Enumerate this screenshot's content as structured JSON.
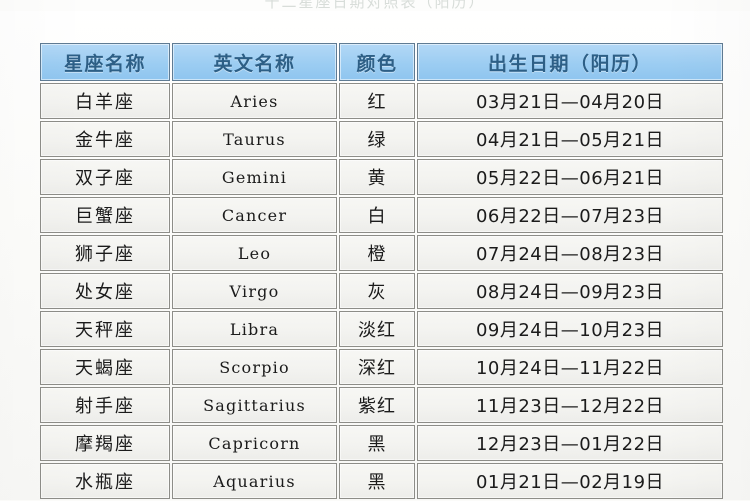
{
  "page": {
    "top_title_fragment": "十二星座日期对照表（阳历）"
  },
  "table": {
    "headers": [
      "星座名称",
      "英文名称",
      "颜色",
      "出生日期（阳历）"
    ],
    "rows": [
      {
        "name": "白羊座",
        "english": "Aries",
        "color": "红",
        "date": "03月21日—04月20日"
      },
      {
        "name": "金牛座",
        "english": "Taurus",
        "color": "绿",
        "date": "04月21日—05月21日"
      },
      {
        "name": "双子座",
        "english": "Gemini",
        "color": "黄",
        "date": "05月22日—06月21日"
      },
      {
        "name": "巨蟹座",
        "english": "Cancer",
        "color": "白",
        "date": "06月22日—07月23日"
      },
      {
        "name": "狮子座",
        "english": "Leo",
        "color": "橙",
        "date": "07月24日—08月23日"
      },
      {
        "name": "处女座",
        "english": "Virgo",
        "color": "灰",
        "date": "08月24日—09月23日"
      },
      {
        "name": "天秤座",
        "english": "Libra",
        "color": "淡红",
        "date": "09月24日—10月23日"
      },
      {
        "name": "天蝎座",
        "english": "Scorpio",
        "color": "深红",
        "date": "10月24日—11月22日"
      },
      {
        "name": "射手座",
        "english": "Sagittarius",
        "color": "紫红",
        "date": "11月23日—12月22日"
      },
      {
        "name": "摩羯座",
        "english": "Capricorn",
        "color": "黑",
        "date": "12月23日—01月22日"
      },
      {
        "name": "水瓶座",
        "english": "Aquarius",
        "color": "黑",
        "date": "01月21日—02月19日"
      }
    ]
  },
  "colors": {
    "header_fill": "#9ccdf2",
    "header_text": "#2d5f86",
    "cell_fill": "#f3f3f0",
    "cell_text": "#1b1b1b",
    "border": "#8d8d88",
    "page_background": "#fbfbf9"
  }
}
